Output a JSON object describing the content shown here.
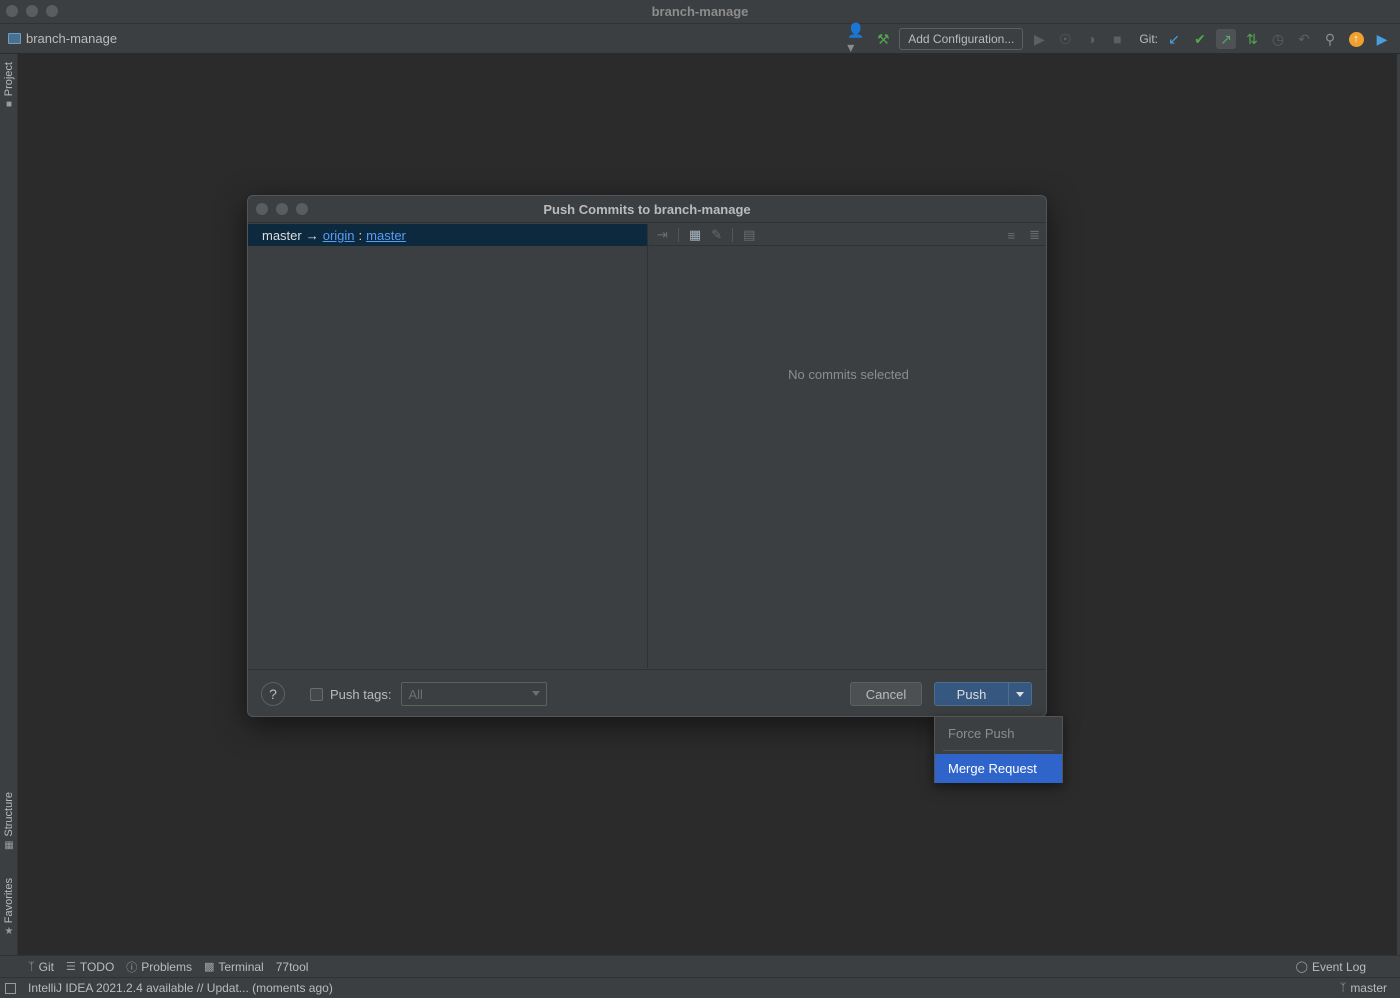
{
  "window": {
    "title": "branch-manage"
  },
  "navbar": {
    "project": "branch-manage",
    "add_configuration": "Add Configuration...",
    "git_label": "Git:"
  },
  "left_stripe": {
    "project": "Project",
    "structure": "Structure",
    "favorites": "Favorites"
  },
  "dialog": {
    "title": "Push Commits to branch-manage",
    "repo": {
      "local": "master",
      "arrow": "→",
      "remote": "origin",
      "sep": ":",
      "remote_branch": "master"
    },
    "empty_text": "No commits selected",
    "help": "?",
    "push_tags_label": "Push tags:",
    "push_tags_value": "All",
    "cancel": "Cancel",
    "push": "Push"
  },
  "push_menu": {
    "items": [
      "Force Push",
      "Merge Request"
    ]
  },
  "bottom_bar": {
    "items": [
      "Git",
      "TODO",
      "Problems",
      "Terminal",
      "77tool"
    ],
    "event_log": "Event Log"
  },
  "status_bar": {
    "message": "IntelliJ IDEA 2021.2.4 available // Updat... (moments ago)",
    "branch": "master"
  },
  "colors": {
    "accent": "#2f65ca",
    "push_button": "#365880",
    "selection": "#0d293e",
    "link": "#589df6"
  }
}
